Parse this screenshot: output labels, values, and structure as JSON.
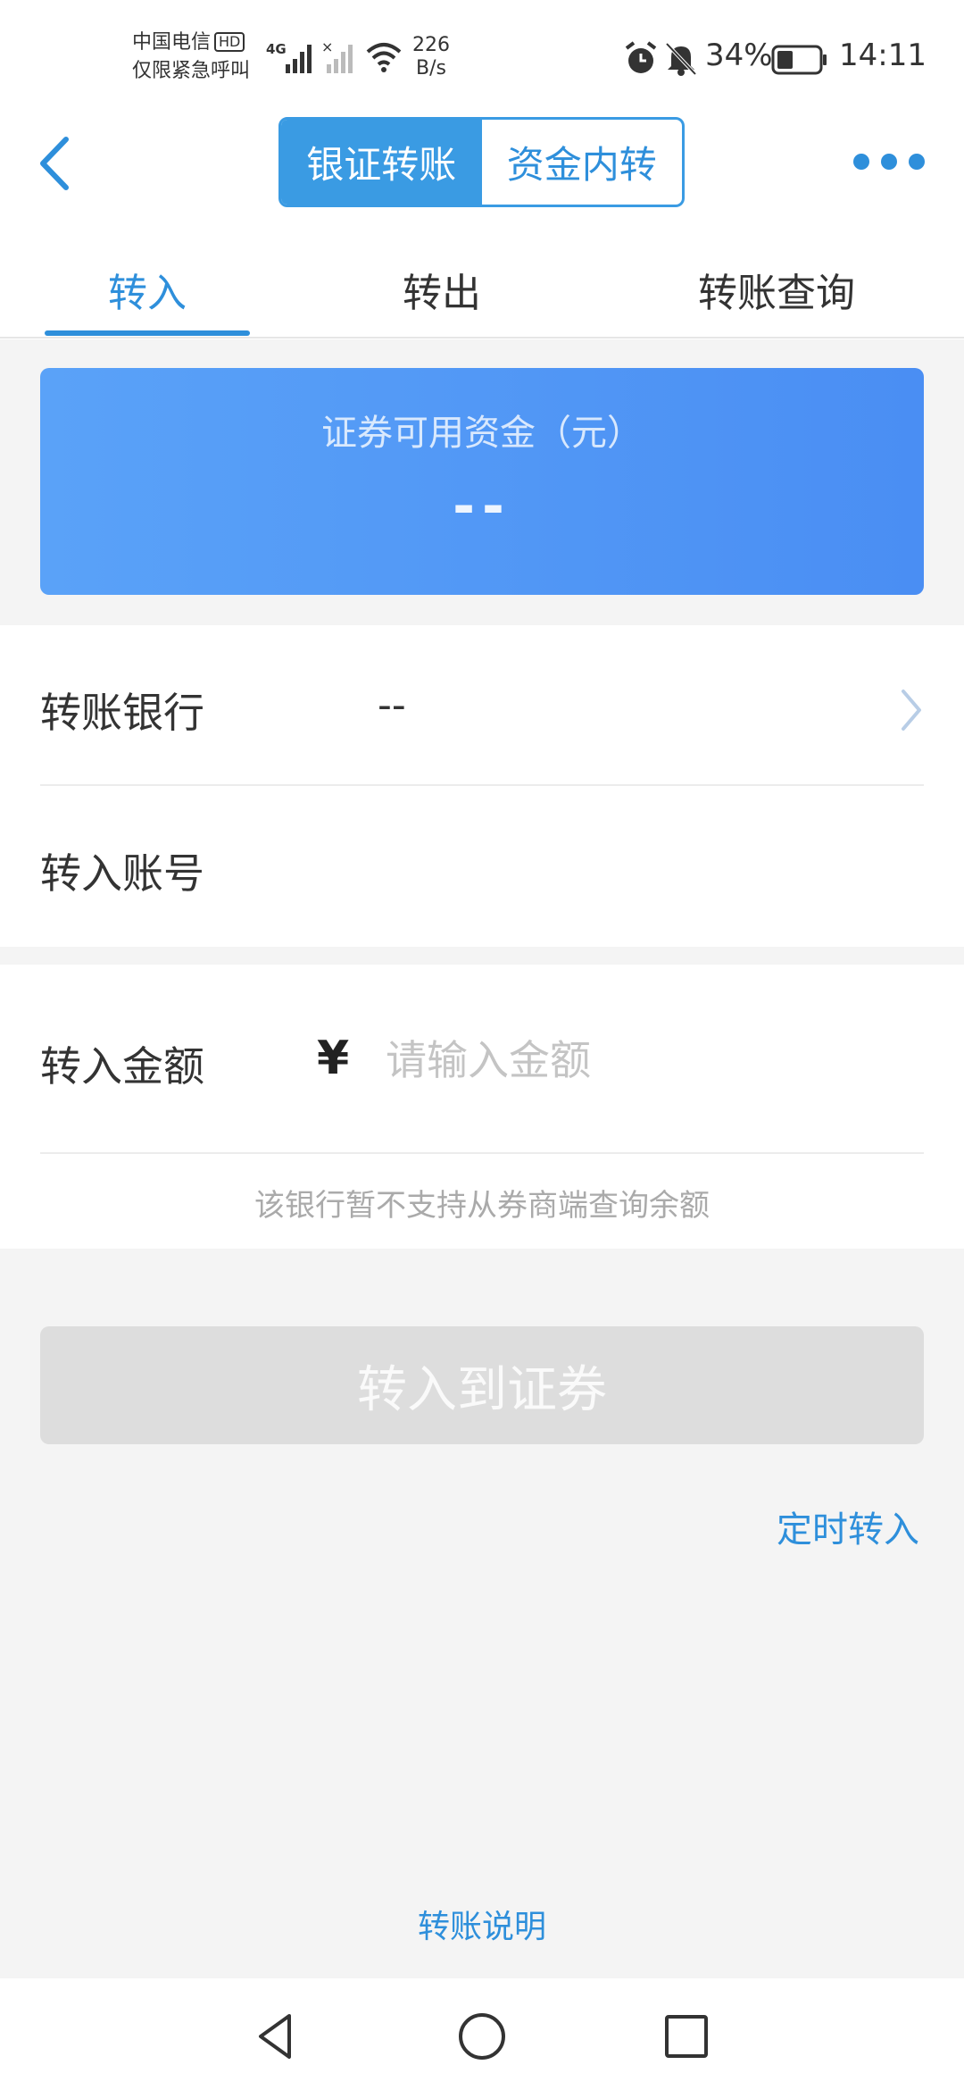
{
  "status_bar": {
    "carrier_line1": "中国电信",
    "hd_badge": "HD",
    "carrier_line2": "仅限紧急呼叫",
    "network_type": "4G",
    "speed_value": "226",
    "speed_unit": "B/s",
    "battery_percent": "34%",
    "time": "14:11",
    "icons": [
      "signal-icon",
      "signal-no-service-icon",
      "wifi-icon",
      "alarm-icon",
      "mute-bell-icon",
      "battery-icon"
    ]
  },
  "header": {
    "back_icon": "back-arrow-icon",
    "segments": [
      {
        "label": "银证转账",
        "active": true
      },
      {
        "label": "资金内转",
        "active": false
      }
    ],
    "more_icon": "more-dots-icon",
    "accent_color": "#2e8fdb"
  },
  "tabs": [
    {
      "label": "转入",
      "active": true
    },
    {
      "label": "转出",
      "active": false
    },
    {
      "label": "转账查询",
      "active": false
    }
  ],
  "funds_card": {
    "title": "证券可用资金（元）",
    "value": "--"
  },
  "form": {
    "bank_label": "转账银行",
    "bank_value": "--",
    "account_label": "转入账号",
    "amount_label": "转入金额",
    "currency_symbol": "¥",
    "amount_placeholder": "请输入金额",
    "amount_value": "",
    "hint": "该银行暂不支持从券商端查询余额"
  },
  "actions": {
    "submit_label": "转入到证券",
    "scheduled_label": "定时转入",
    "explain_label": "转账说明"
  },
  "nav_bar": {
    "icons": [
      "back-triangle-icon",
      "home-circle-icon",
      "recents-square-icon"
    ]
  }
}
